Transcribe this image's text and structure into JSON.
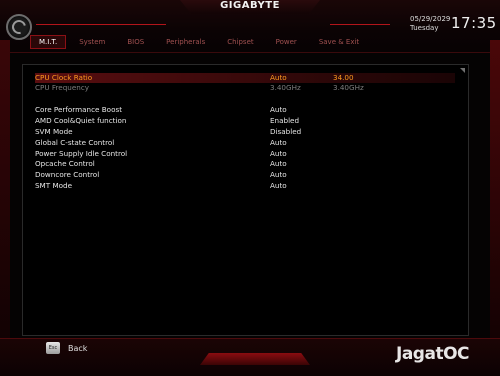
{
  "header": {
    "brand": "GIGABYTE",
    "date": "05/29/2029",
    "weekday": "Tuesday",
    "time": "17:35",
    "tabs": [
      {
        "label": "M.I.T."
      },
      {
        "label": "System"
      },
      {
        "label": "BIOS"
      },
      {
        "label": "Peripherals"
      },
      {
        "label": "Chipset"
      },
      {
        "label": "Power"
      },
      {
        "label": "Save & Exit"
      }
    ],
    "active_tab": "M.I.T."
  },
  "settings": {
    "rows": [
      {
        "label": "CPU Clock Ratio",
        "value": "Auto",
        "current": "34.00"
      },
      {
        "label": "CPU Frequency",
        "value": "3.40GHz",
        "current": "3.40GHz"
      },
      {
        "label": "Core Performance Boost",
        "value": "Auto"
      },
      {
        "label": "AMD Cool&Quiet function",
        "value": "Enabled"
      },
      {
        "label": "SVM Mode",
        "value": "Disabled"
      },
      {
        "label": "Global C-state Control",
        "value": "Auto"
      },
      {
        "label": "Power Supply Idle Control",
        "value": "Auto"
      },
      {
        "label": "Opcache Control",
        "value": "Auto"
      },
      {
        "label": "Downcore Control",
        "value": "Auto"
      },
      {
        "label": "SMT Mode",
        "value": "Auto"
      }
    ]
  },
  "footer": {
    "back_key": "Esc",
    "back_label": "Back",
    "watermark": "JagatOC"
  },
  "colors": {
    "accent": "#b3141a",
    "highlight_text": "#ff9a1f",
    "muted_text": "#7e7e7e"
  }
}
